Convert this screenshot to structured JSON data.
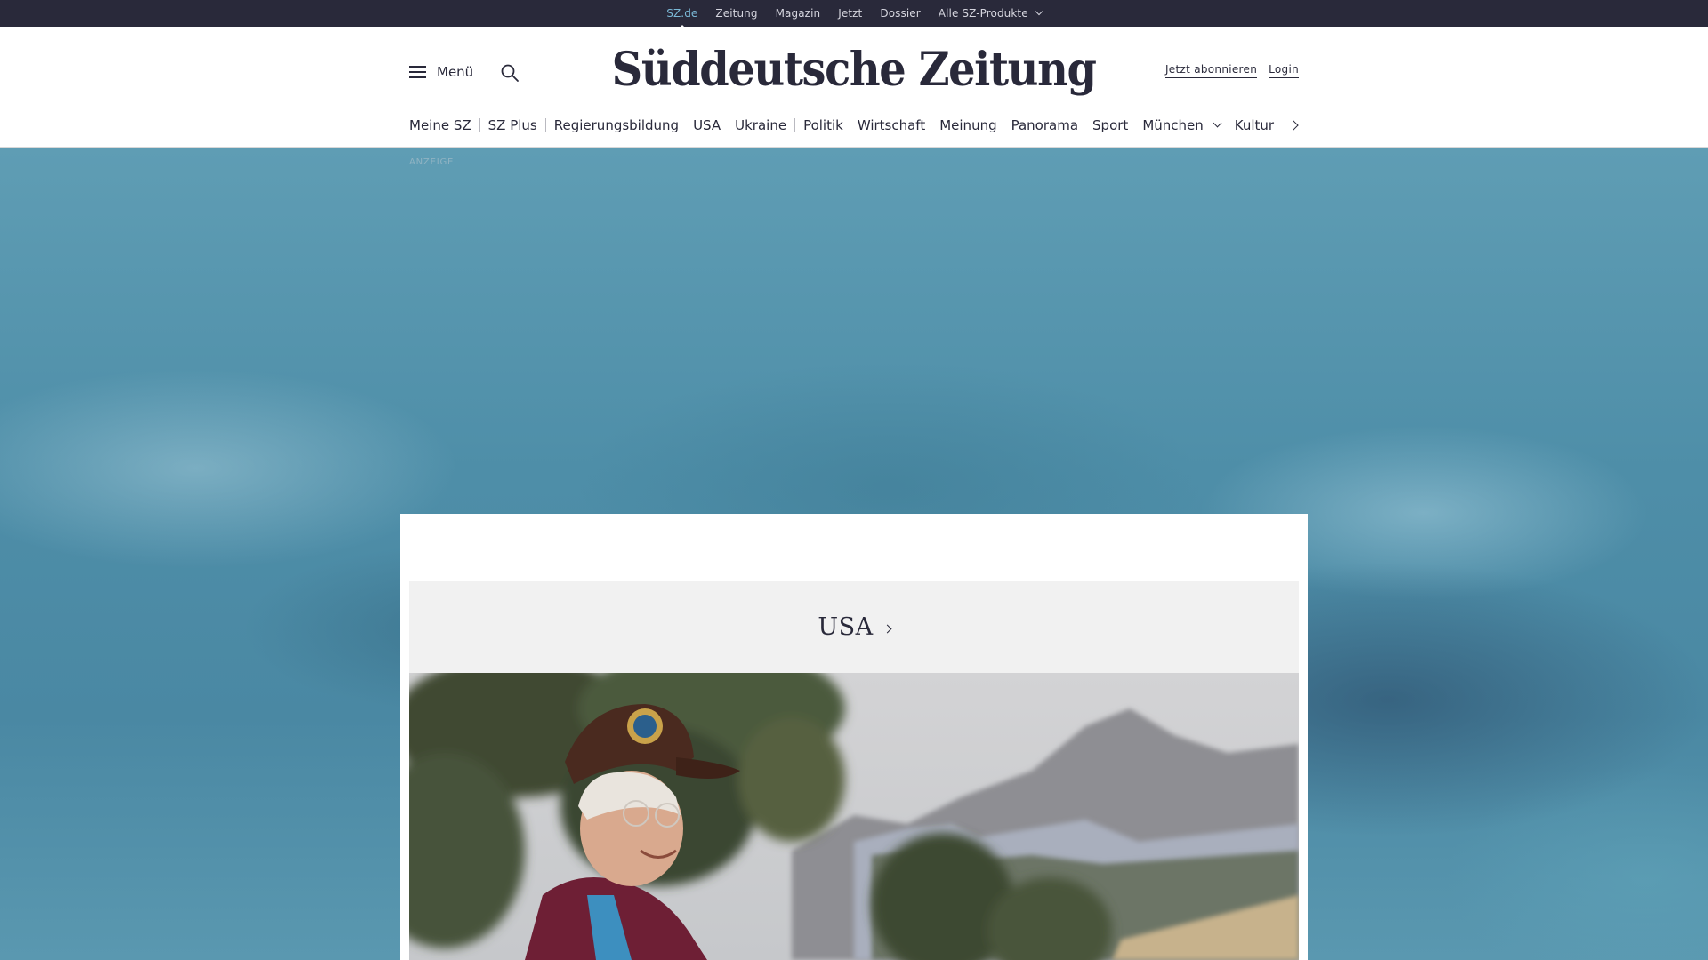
{
  "topbar": {
    "links": [
      "SZ.de",
      "Zeitung",
      "Magazin",
      "Jetzt",
      "Dossier"
    ],
    "products_label": "Alle SZ-Produkte"
  },
  "header": {
    "menu_label": "Menü",
    "logo_text": "Süddeutsche Zeitung",
    "subscribe_label": "Jetzt abonnieren",
    "login_label": "Login"
  },
  "nav": {
    "items": [
      "Meine SZ",
      "SZ Plus",
      "Regierungsbildung",
      "USA",
      "Ukraine",
      "Politik",
      "Wirtschaft",
      "Meinung",
      "Panorama",
      "Sport",
      "München",
      "Kultur"
    ]
  },
  "ad": {
    "label": "ANZEIGE"
  },
  "section": {
    "title": "USA"
  },
  "colors": {
    "topbar_bg": "#29293a",
    "active_link": "#7ab8d6",
    "text_dark": "#29293a",
    "ad_background": "#4e8ea8",
    "section_bg": "#f1f1f1"
  },
  "icons": {
    "menu": "hamburger-icon",
    "search": "search-icon",
    "products_dropdown": "chevron-down-icon",
    "nav_next": "chevron-right-icon",
    "section_link": "chevron-right-icon"
  }
}
